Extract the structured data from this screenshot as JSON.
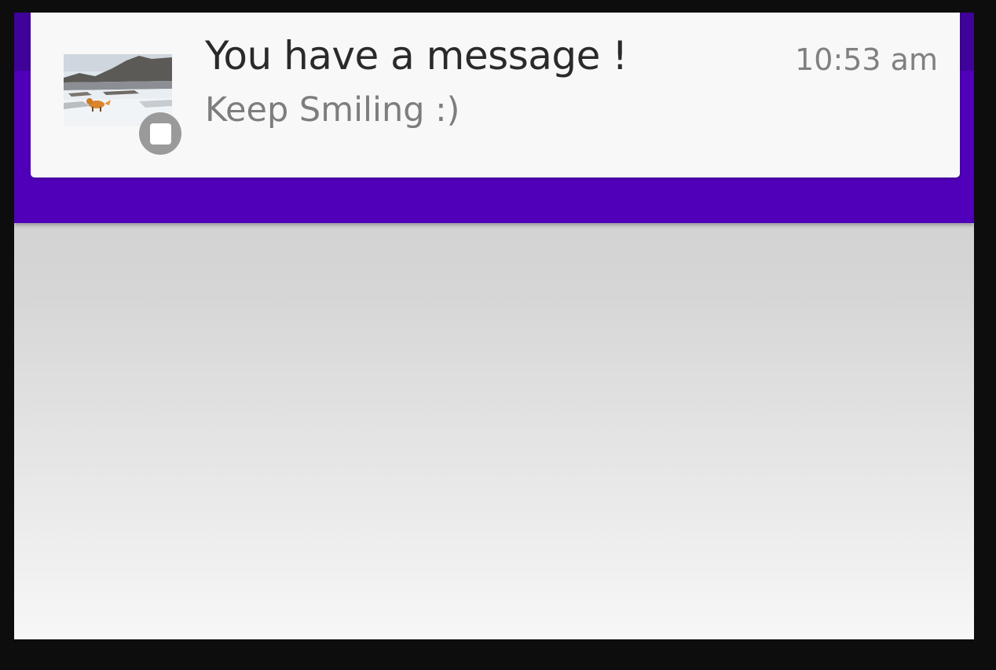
{
  "notification": {
    "title": "You have a message !",
    "text": "Keep Smiling :)",
    "time": "10:53 am",
    "thumbnail_icon": "snowy-landscape-fox-image",
    "badge_icon": "app-badge-icon"
  },
  "colors": {
    "app_bar": "#5000b8",
    "app_bar_dark": "#3f0399",
    "card": "#f8f8f8",
    "title_text": "#2a2a2a",
    "secondary_text": "#7d7d7d"
  }
}
